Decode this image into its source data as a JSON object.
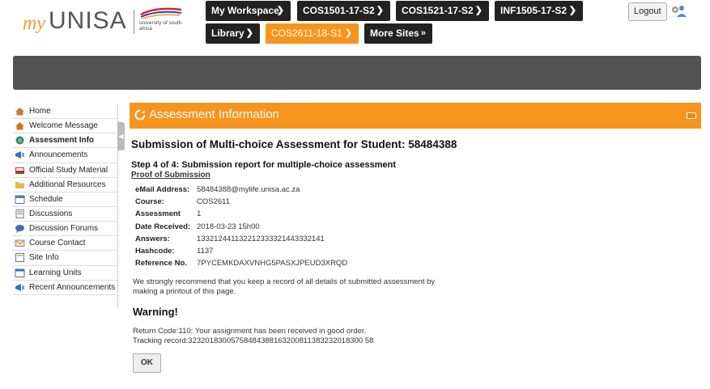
{
  "logo": {
    "my": "my",
    "unisa": "UNISA",
    "subtitle": "university of south africa"
  },
  "top_nav": [
    {
      "label": "My Workspace"
    },
    {
      "label": "COS1501-17-S2"
    },
    {
      "label": "COS1521-17-S2"
    },
    {
      "label": "INF1505-17-S2"
    },
    {
      "label": "Library"
    },
    {
      "label": "COS2611-18-S1"
    },
    {
      "label": "More Sites"
    }
  ],
  "logout_label": "Logout",
  "sidebar": {
    "items": [
      {
        "label": "Home"
      },
      {
        "label": "Welcome Message"
      },
      {
        "label": "Assessment Info"
      },
      {
        "label": "Announcements"
      },
      {
        "label": "Official Study Material"
      },
      {
        "label": "Additional Resources"
      },
      {
        "label": "Schedule"
      },
      {
        "label": "Discussions"
      },
      {
        "label": "Discussion Forums"
      },
      {
        "label": "Course Contact"
      },
      {
        "label": "Site Info"
      },
      {
        "label": "Learning Units"
      },
      {
        "label": "Recent Announcements"
      }
    ]
  },
  "tool": {
    "title": "Assessment Information"
  },
  "main": {
    "heading": "Submission of Multi-choice Assessment for Student: 58484388",
    "step": "Step 4 of 4: Submission report for multiple-choice assessment",
    "proof": "Proof of Submission",
    "rows": [
      {
        "label": "eMail Address:",
        "value": "58484388@mylife.unisa.ac.za"
      },
      {
        "label": "Course:",
        "value": "COS2611"
      },
      {
        "label": "Assessment",
        "value": "1"
      },
      {
        "label": "Date Received:",
        "value": "2018-03-23 15h00"
      },
      {
        "label": "Answers:",
        "value": "133212441132212333321443332141"
      },
      {
        "label": "Hashcode:",
        "value": "1137"
      },
      {
        "label": "Reference No.",
        "value": "7PYCEMKDAXVNHG5PASXJPEUD3XRQD"
      }
    ],
    "note": "We strongly recommend that you keep a record of all details of submitted assessment by making a printout of this page.",
    "warning": "Warning!",
    "return_code": "Return Code:110: Your assignment has been received in good order.",
    "tracking": "Tracking record:32320183005758484388163200811383232018300 58",
    "ok_label": "OK"
  }
}
